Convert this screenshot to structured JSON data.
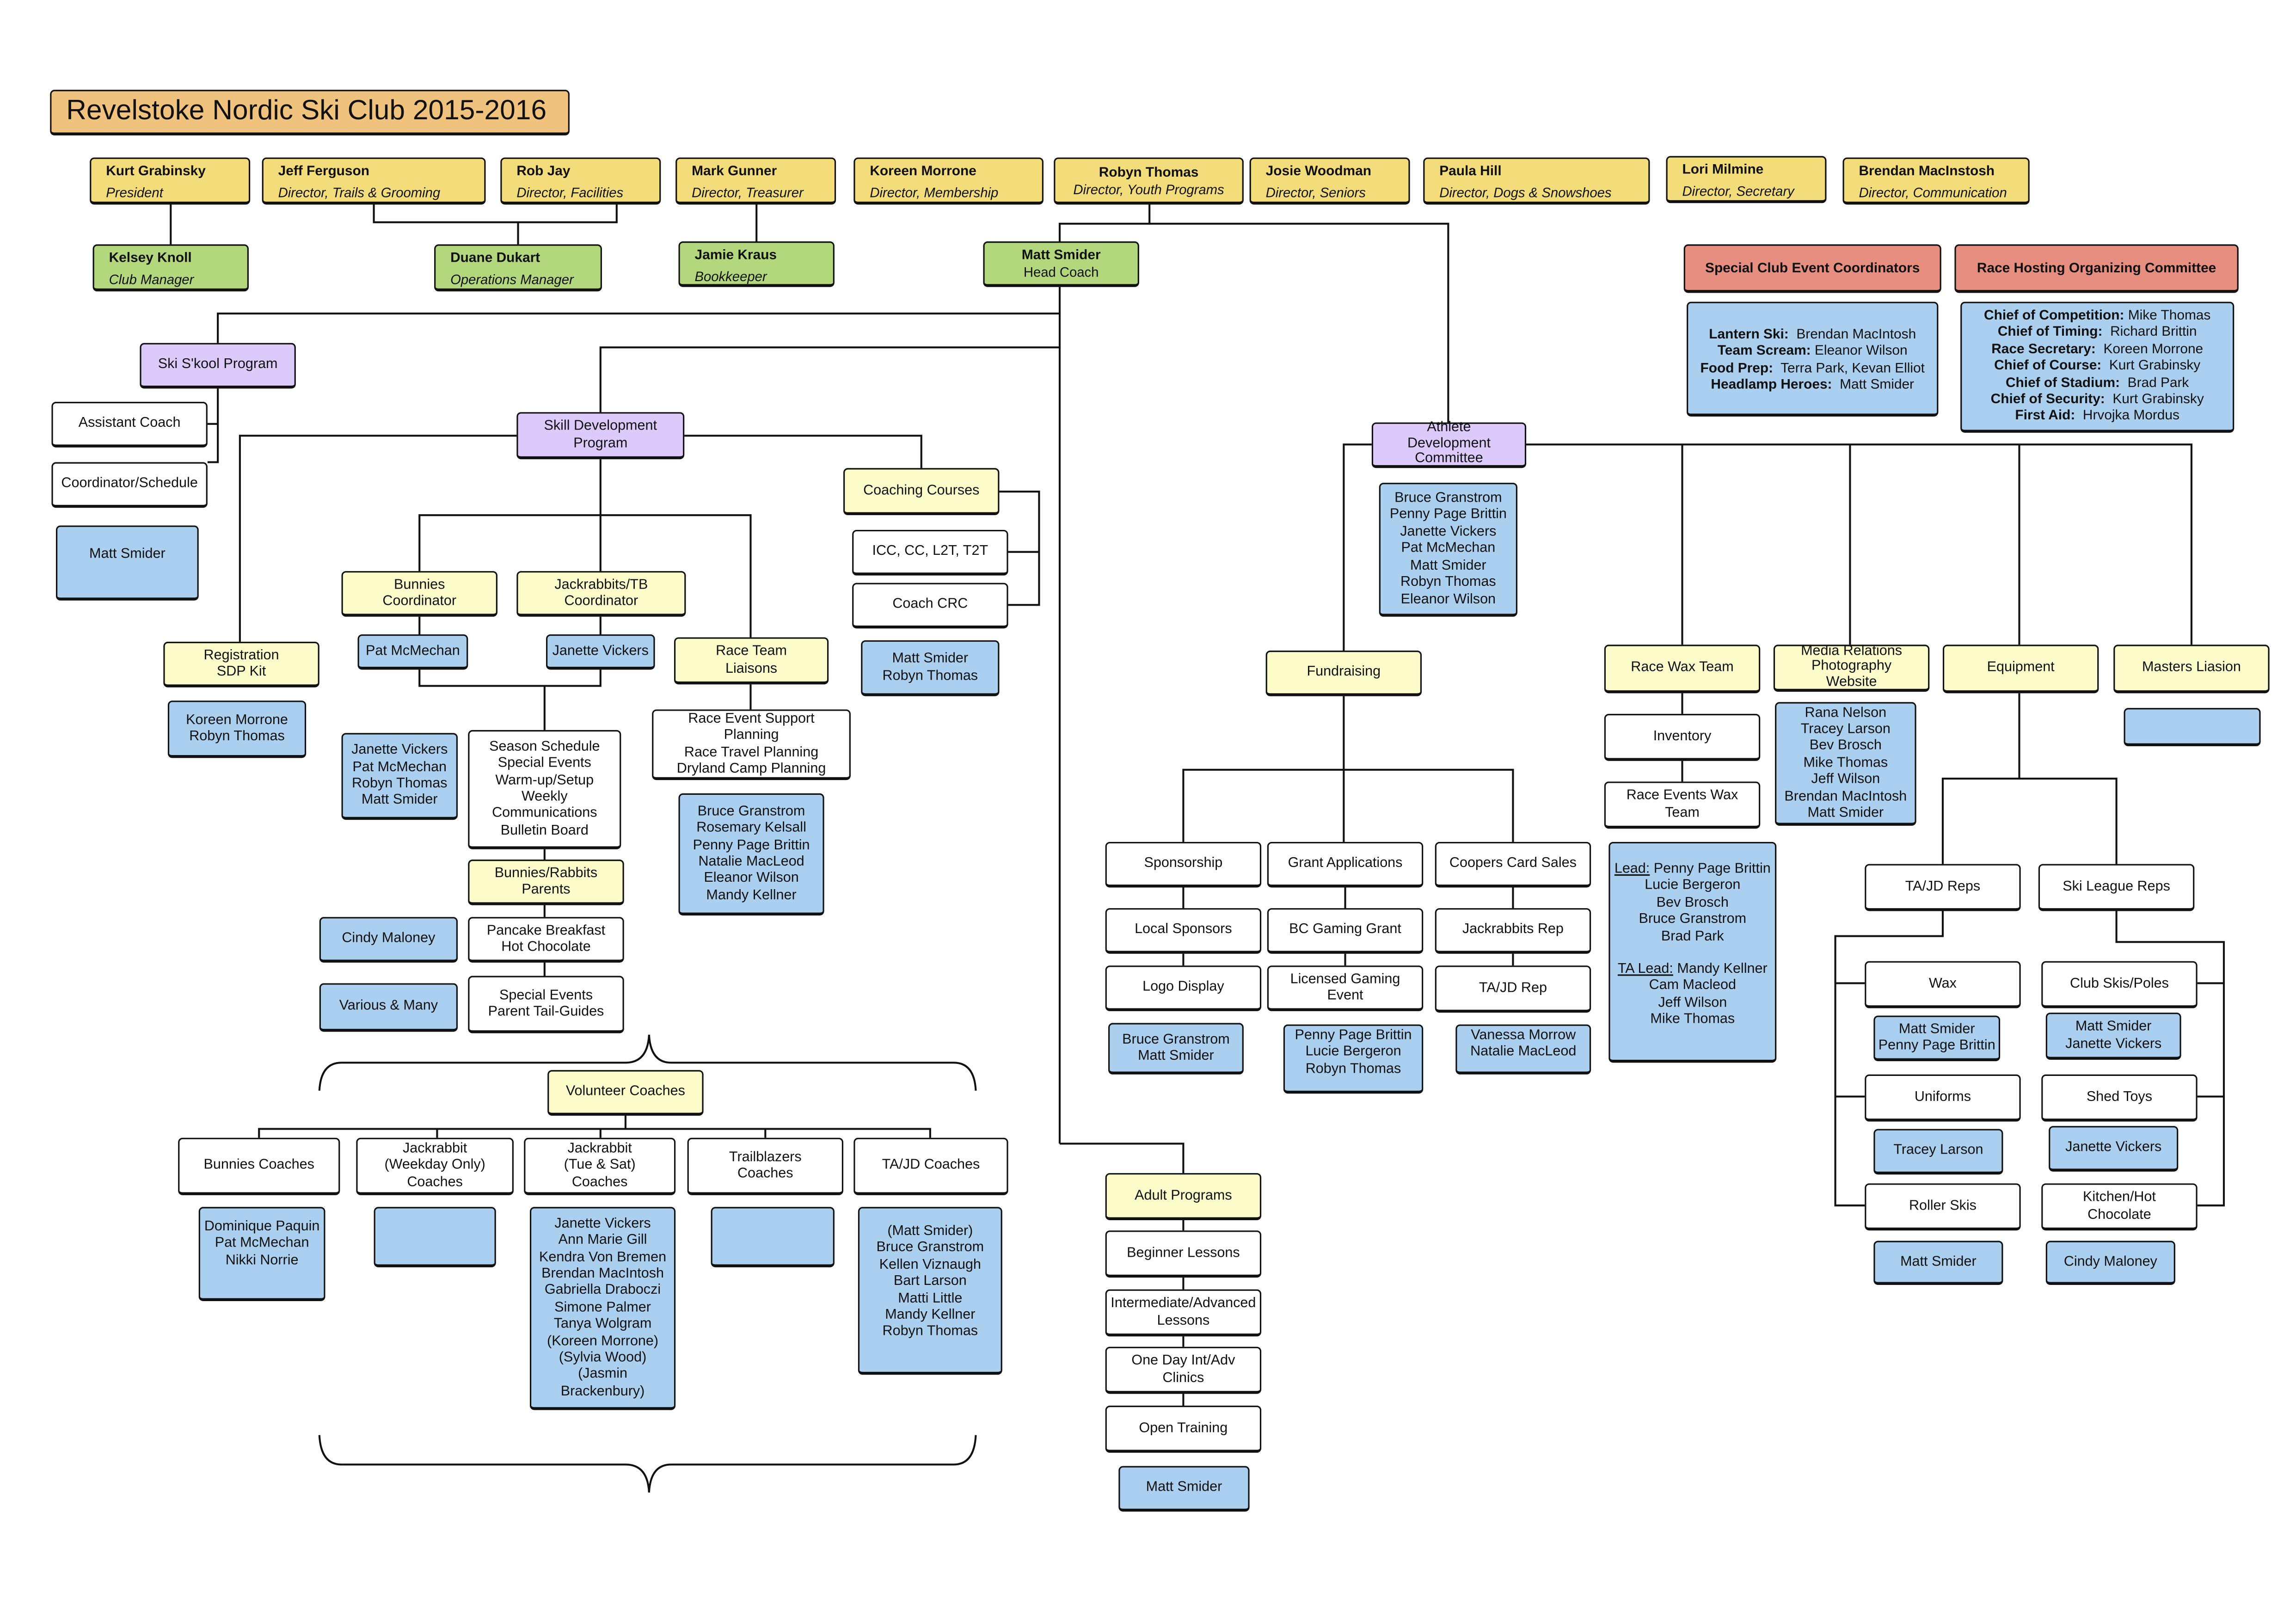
{
  "title": "Revelstoke Nordic Ski Club 2015-2016",
  "directors": [
    {
      "name": "Kurt Grabinsky",
      "role": "President"
    },
    {
      "name": "Jeff Ferguson",
      "role": "Director, Trails & Grooming"
    },
    {
      "name": "Rob Jay",
      "role": "Director, Facilities"
    },
    {
      "name": "Mark Gunner",
      "role": "Director, Treasurer"
    },
    {
      "name": "Koreen Morrone",
      "role": "Director, Membership"
    },
    {
      "name": "Robyn Thomas",
      "role": "Director, Youth Programs"
    },
    {
      "name": "Josie Woodman",
      "role": "Director, Seniors"
    },
    {
      "name": "Paula Hill",
      "role": "Director, Dogs & Snowshoes"
    },
    {
      "name": "Lori Milmine",
      "role": "Director, Secretary"
    },
    {
      "name": "Brendan MacInstosh",
      "role": "Director, Communication"
    }
  ],
  "staff": [
    {
      "name": "Kelsey Knoll",
      "role": "Club Manager"
    },
    {
      "name": "Duane Dukart",
      "role": "Operations Manager"
    },
    {
      "name": "Jamie Kraus",
      "role": "Bookkeeper"
    },
    {
      "name": "Matt Smider",
      "role": "Head Coach"
    }
  ],
  "committees": {
    "special_events": {
      "title": "Special Club Event Coordinators",
      "entries": [
        {
          "key": "Lantern Ski:",
          "value": "Brendan MacIntosh"
        },
        {
          "key": "Team Scream:",
          "value": "Eleanor Wilson"
        },
        {
          "key": "Food Prep:",
          "value": "Terra Park, Kevan Elliot"
        },
        {
          "key": "Headlamp Heroes:",
          "value": "Matt Smider"
        }
      ]
    },
    "race_hosting": {
      "title": "Race Hosting Organizing Committee",
      "entries": [
        {
          "key": "Chief of Competition:",
          "value": "Mike Thomas"
        },
        {
          "key": "Chief of Timing:",
          "value": "Richard Brittin"
        },
        {
          "key": "Race Secretary:",
          "value": "Koreen Morrone"
        },
        {
          "key": "Chief of Course:",
          "value": "Kurt Grabinsky"
        },
        {
          "key": "Chief of Stadium:",
          "value": "Brad Park"
        },
        {
          "key": "Chief of Security:",
          "value": "Kurt Grabinsky"
        },
        {
          "key": "First Aid:",
          "value": "Hrvojka Mordus"
        }
      ]
    }
  },
  "ski_skool": {
    "title": "Ski S'kool Program",
    "roles": [
      "Assistant Coach",
      "Coordinator/Schedule"
    ],
    "people": "Matt Smider"
  },
  "skill_dev": {
    "title": "Skill Development\nProgram",
    "registration": {
      "title": "Registration\nSDP Kit",
      "people": "Koreen Morrone\nRobyn Thomas"
    },
    "bunnies_coord": {
      "title": "Bunnies\nCoordinator",
      "people": "Pat McMechan"
    },
    "jackrabbits_coord": {
      "title": "Jackrabbits/TB\nCoordinator",
      "people": "Janette Vickers"
    },
    "coord_people": "Janette Vickers\nPat McMechan\nRobyn Thomas\nMatt Smider",
    "coord_tasks": "Season Schedule\nSpecial Events\nWarm-up/Setup\nWeekly\nCommunications\nBulletin Board",
    "parents": {
      "title": "Bunnies/Rabbits\nParents"
    },
    "pancake": {
      "title": "Pancake Breakfast\nHot Chocolate",
      "people": "Cindy Maloney"
    },
    "parent_events": {
      "title": "Special Events\nParent Tail-Guides",
      "people": "Various & Many"
    },
    "race_team": {
      "title": "Race Team\nLiaisons",
      "tasks": "Race Event Support\nPlanning\nRace Travel Planning\nDryland Camp Planning",
      "people": "Bruce Granstrom\nRosemary Kelsall\nPenny Page Brittin\nNatalie MacLeod\nEleanor Wilson\nMandy Kellner"
    },
    "coaching_courses": {
      "title": "Coaching Courses",
      "items": [
        "ICC, CC, L2T, T2T",
        "Coach CRC"
      ],
      "people": "Matt Smider\nRobyn Thomas"
    }
  },
  "volunteer_coaches": {
    "title": "Volunteer Coaches",
    "groups": [
      {
        "title": "Bunnies Coaches",
        "people": "Dominique Paquin\nPat McMechan\nNikki Norrie"
      },
      {
        "title": "Jackrabbit\n(Weekday Only)\nCoaches",
        "people": ""
      },
      {
        "title": "Jackrabbit\n(Tue & Sat)\nCoaches",
        "people": "Janette Vickers\nAnn Marie Gill\nKendra Von Bremen\nBrendan MacIntosh\nGabriella Draboczi\nSimone Palmer\nTanya Wolgram\n(Koreen Morrone)\n(Sylvia Wood)\n(Jasmin Brackenbury)"
      },
      {
        "title": "Trailblazers\nCoaches",
        "people": ""
      },
      {
        "title": "TA/JD Coaches",
        "people": "(Matt Smider)\nBruce Granstrom\nKellen Viznaugh\nBart Larson\nMatti Little\nMandy Kellner\nRobyn Thomas"
      }
    ]
  },
  "adult_programs": {
    "title": "Adult Programs",
    "items": [
      "Beginner Lessons",
      "Intermediate/Advanced\nLessons",
      "One Day Int/Adv\nClinics",
      "Open Training"
    ],
    "people": "Matt Smider"
  },
  "athlete_dev": {
    "title": "Athlete\nDevelopment\nCommittee",
    "people": "Bruce Granstrom\nPenny Page Brittin\nJanette Vickers\nPat McMechan\nMatt Smider\nRobyn Thomas\nEleanor Wilson"
  },
  "fundraising": {
    "title": "Fundraising",
    "columns": [
      {
        "title": "Sponsorship",
        "items": [
          "Local Sponsors",
          "Logo Display"
        ],
        "people": "Bruce Granstrom\nMatt Smider"
      },
      {
        "title": "Grant Applications",
        "items": [
          "BC Gaming Grant",
          "Licensed Gaming\nEvent"
        ],
        "people": "Penny Page Brittin\nLucie Bergeron\nRobyn Thomas"
      },
      {
        "title": "Coopers Card Sales",
        "items": [
          "Jackrabbits Rep",
          "TA/JD Rep"
        ],
        "people": "Vanessa Morrow\nNatalie MacLeod"
      }
    ]
  },
  "race_wax": {
    "title": "Race Wax Team",
    "items": [
      "Inventory",
      "Race Events Wax\nTeam"
    ],
    "lead_label": "Lead:",
    "lead": "Penny Page Brittin",
    "members": "Lucie Bergeron\nBev Brosch\nBruce Granstrom\nBrad Park",
    "ta_lead_label": "TA Lead:",
    "ta_lead": "Mandy Kellner",
    "ta_members": "Cam Macleod\nJeff Wilson\nMike Thomas"
  },
  "media": {
    "title": "Media Relations\nPhotography\nWebsite",
    "people": "Rana Nelson\nTracey Larson\nBev Brosch\nMike Thomas\nJeff Wilson\nBrendan MacIntosh\nMatt Smider"
  },
  "equipment": {
    "title": "Equipment",
    "tajd_reps": "TA/JD Reps",
    "ski_league_reps": "Ski League Reps",
    "left": [
      {
        "title": "Wax",
        "people": "Matt Smider\nPenny Page Brittin"
      },
      {
        "title": "Uniforms",
        "people": "Tracey Larson"
      },
      {
        "title": "Roller Skis",
        "people": "Matt Smider"
      }
    ],
    "right": [
      {
        "title": "Club Skis/Poles",
        "people": "Matt Smider\nJanette Vickers"
      },
      {
        "title": "Shed Toys",
        "people": "Janette Vickers"
      },
      {
        "title": "Kitchen/Hot\nChocolate",
        "people": "Cindy Maloney"
      }
    ]
  },
  "masters": {
    "title": "Masters Liasion",
    "people": ""
  },
  "colors": {
    "title_bg": "#efc37d",
    "director_bg": "#f3dc7a",
    "staff_bg": "#b3d77c",
    "committee_bg": "#e68f80",
    "program_bg": "#dccbfa",
    "area_bg": "#fcfccb",
    "people_bg": "#abd0ef",
    "task_bg": "#ffffff"
  }
}
